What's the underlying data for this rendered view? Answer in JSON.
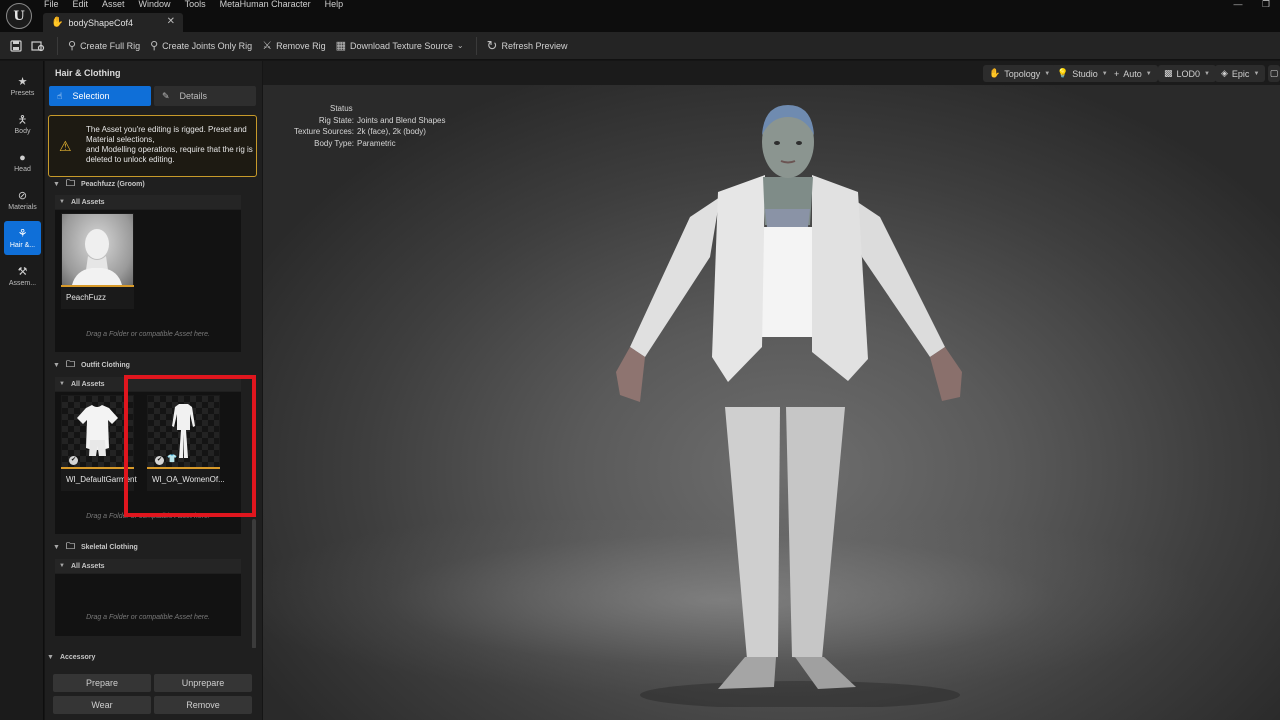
{
  "app": {
    "logo_text": "U"
  },
  "menu": [
    "File",
    "Edit",
    "Asset",
    "Window",
    "Tools",
    "MetaHuman Character",
    "Help"
  ],
  "tab": {
    "label": "bodyShapeCof4",
    "close": "✕"
  },
  "window_controls": {
    "minimize": "—",
    "restore": "❐"
  },
  "toolbar": {
    "save_icon": "save-icon",
    "buttons": [
      {
        "label": "Create Full Rig",
        "icon": "rig-icon"
      },
      {
        "label": "Create Joints Only Rig",
        "icon": "joints-icon"
      },
      {
        "label": "Remove Rig",
        "icon": "remove-rig-icon"
      },
      {
        "label": "Download Texture Source",
        "icon": "download-icon"
      },
      {
        "label": "Refresh Preview",
        "icon": "refresh-icon"
      }
    ]
  },
  "leftnav": [
    {
      "label": "Presets",
      "icon": "star-icon",
      "active": false
    },
    {
      "label": "Body",
      "icon": "body-icon",
      "active": false
    },
    {
      "label": "Head",
      "icon": "head-icon",
      "active": false
    },
    {
      "label": "Materials",
      "icon": "materials-icon",
      "active": false
    },
    {
      "label": "Hair &...",
      "icon": "hair-icon",
      "active": true
    },
    {
      "label": "Assem...",
      "icon": "hammer-icon",
      "active": false
    }
  ],
  "panel": {
    "title": "Hair & Clothing",
    "seg_selection": "Selection",
    "seg_details": "Details",
    "warning": "The Asset you're editing is rigged. Preset and Material selections,\nand Modelling operations, require that the rig is deleted to unlock editing.",
    "peach_section": "Peachfuzz (Groom)",
    "all_assets": "All Assets",
    "peach_tile": "PeachFuzz",
    "drop_hint": "Drag a Folder or compatible Asset here.",
    "outfit_section": "Outfit Clothing",
    "outfit_tiles": [
      "WI_DefaultGarment",
      "WI_OA_WomenOf..."
    ],
    "skeletal_section": "Skeletal Clothing",
    "accessory_section": "Accessory",
    "prepare": "Prepare",
    "unprepare": "Unprepare",
    "wear": "Wear",
    "remove": "Remove"
  },
  "viewport": {
    "pills": [
      "Topology",
      "Studio",
      "Auto",
      "LOD0",
      "Epic"
    ],
    "status": {
      "header": "Status",
      "rows": [
        {
          "k": "Rig State:",
          "v": "Joints and Blend Shapes"
        },
        {
          "k": "Texture Sources:",
          "v": "2k (face), 2k (body)"
        },
        {
          "k": "Body Type:",
          "v": "Parametric"
        }
      ]
    }
  },
  "colors": {
    "accent": "#0f6fd8",
    "warning": "#c79a2a",
    "highlight": "#e0161e",
    "asset_bar": "#d89a2a"
  }
}
